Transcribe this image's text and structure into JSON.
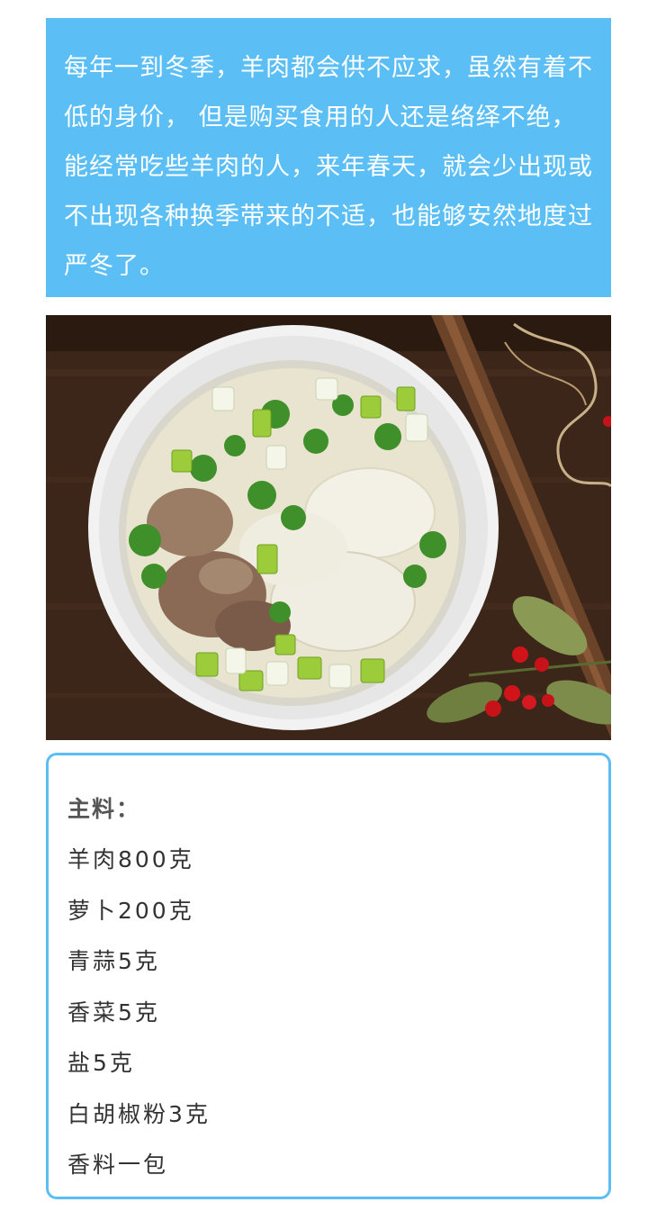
{
  "intro": {
    "text": "每年一到冬季，羊肉都会供不应求，虽然有着不低的身价， 但是购买食用的人还是络绎不绝，能经常吃些羊肉的人，来年春天，就会少出现或不出现各种换季带来的不适，也能够安然地度过严冬了。"
  },
  "photo": {
    "subject": "mutton-radish-soup-photo"
  },
  "ingredients": {
    "heading": "主料：",
    "items": [
      "羊肉800克",
      "萝卜200克",
      "青蒜5克",
      "香菜5克",
      "盐5克",
      "白胡椒粉3克",
      "香料一包"
    ]
  },
  "colors": {
    "accent": "#5bbff5",
    "intro_text": "#ffffff",
    "heading_text": "#555555",
    "body_text": "#333333"
  }
}
